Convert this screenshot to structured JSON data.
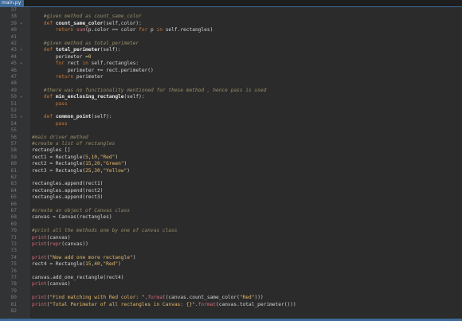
{
  "tab": {
    "label": "main.py"
  },
  "lines": [
    {
      "n": "37",
      "fold": "",
      "indent": "",
      "tokens": []
    },
    {
      "n": "38",
      "fold": "",
      "indent": "    ",
      "tokens": [
        {
          "t": "#given method as count_same_color",
          "c": "t-comment"
        }
      ]
    },
    {
      "n": "39",
      "fold": "▾",
      "indent": "    ",
      "tokens": [
        {
          "t": "def ",
          "c": "t-kw"
        },
        {
          "t": "count_same_color",
          "c": "t-name"
        },
        {
          "t": "(self,color):",
          "c": "t-plain"
        }
      ]
    },
    {
      "n": "40",
      "fold": "",
      "indent": "        ",
      "tokens": [
        {
          "t": "return ",
          "c": "t-kw"
        },
        {
          "t": "sum",
          "c": "t-builtin"
        },
        {
          "t": "(p.color == color ",
          "c": "t-plain"
        },
        {
          "t": "for ",
          "c": "t-kw"
        },
        {
          "t": "p ",
          "c": "t-plain"
        },
        {
          "t": "in ",
          "c": "t-kw"
        },
        {
          "t": "self.rectangles)",
          "c": "t-plain"
        }
      ]
    },
    {
      "n": "41",
      "fold": "",
      "indent": "",
      "tokens": []
    },
    {
      "n": "42",
      "fold": "",
      "indent": "    ",
      "tokens": [
        {
          "t": "#given method as total_perimeter",
          "c": "t-comment"
        }
      ]
    },
    {
      "n": "43",
      "fold": "▾",
      "indent": "    ",
      "tokens": [
        {
          "t": "def ",
          "c": "t-kw"
        },
        {
          "t": "total_perimeter",
          "c": "t-name"
        },
        {
          "t": "(self):",
          "c": "t-plain"
        }
      ]
    },
    {
      "n": "44",
      "fold": "",
      "indent": "        ",
      "tokens": [
        {
          "t": "perimeter =",
          "c": "t-plain"
        },
        {
          "t": "0",
          "c": "t-num"
        }
      ]
    },
    {
      "n": "45",
      "fold": "▾",
      "indent": "        ",
      "tokens": [
        {
          "t": "for ",
          "c": "t-kw"
        },
        {
          "t": "rect ",
          "c": "t-plain"
        },
        {
          "t": "in ",
          "c": "t-kw"
        },
        {
          "t": "self.rectangles:",
          "c": "t-plain"
        }
      ]
    },
    {
      "n": "46",
      "fold": "",
      "indent": "            ",
      "tokens": [
        {
          "t": "perimeter += rect.perimeter()",
          "c": "t-plain"
        }
      ]
    },
    {
      "n": "47",
      "fold": "",
      "indent": "        ",
      "tokens": [
        {
          "t": "return ",
          "c": "t-kw"
        },
        {
          "t": "perimeter",
          "c": "t-plain"
        }
      ]
    },
    {
      "n": "48",
      "fold": "",
      "indent": "",
      "tokens": []
    },
    {
      "n": "49",
      "fold": "",
      "indent": "    ",
      "tokens": [
        {
          "t": "#there was no functionality mentioned for these method , hence pass is used",
          "c": "t-comment"
        }
      ]
    },
    {
      "n": "50",
      "fold": "▾",
      "indent": "    ",
      "tokens": [
        {
          "t": "def ",
          "c": "t-kw"
        },
        {
          "t": "min_enclosing_rectangle",
          "c": "t-name"
        },
        {
          "t": "(self):",
          "c": "t-plain"
        }
      ]
    },
    {
      "n": "51",
      "fold": "",
      "indent": "        ",
      "tokens": [
        {
          "t": "pass",
          "c": "t-kw"
        }
      ]
    },
    {
      "n": "52",
      "fold": "",
      "indent": "",
      "tokens": []
    },
    {
      "n": "53",
      "fold": "▾",
      "indent": "    ",
      "tokens": [
        {
          "t": "def ",
          "c": "t-kw"
        },
        {
          "t": "common_point",
          "c": "t-name"
        },
        {
          "t": "(self):",
          "c": "t-plain"
        }
      ]
    },
    {
      "n": "54",
      "fold": "",
      "indent": "        ",
      "tokens": [
        {
          "t": "pass",
          "c": "t-kw"
        }
      ]
    },
    {
      "n": "55",
      "fold": "",
      "indent": "",
      "tokens": []
    },
    {
      "n": "56",
      "fold": "",
      "indent": "",
      "tokens": [
        {
          "t": "#main driver method",
          "c": "t-comment"
        }
      ]
    },
    {
      "n": "57",
      "fold": "",
      "indent": "",
      "tokens": [
        {
          "t": "#create a list of rectangles",
          "c": "t-comment"
        }
      ]
    },
    {
      "n": "58",
      "fold": "",
      "indent": "",
      "tokens": [
        {
          "t": "rectangles []",
          "c": "t-plain"
        }
      ]
    },
    {
      "n": "59",
      "fold": "",
      "indent": "",
      "tokens": [
        {
          "t": "rect1 = Rectangle(",
          "c": "t-plain"
        },
        {
          "t": "5",
          "c": "t-num"
        },
        {
          "t": ",",
          "c": "t-plain"
        },
        {
          "t": "10",
          "c": "t-num"
        },
        {
          "t": ",",
          "c": "t-plain"
        },
        {
          "t": "\"Red\"",
          "c": "t-str"
        },
        {
          "t": ")",
          "c": "t-plain"
        }
      ]
    },
    {
      "n": "60",
      "fold": "",
      "indent": "",
      "tokens": [
        {
          "t": "rect2 = Rectangle(",
          "c": "t-plain"
        },
        {
          "t": "15",
          "c": "t-num"
        },
        {
          "t": ",",
          "c": "t-plain"
        },
        {
          "t": "20",
          "c": "t-num"
        },
        {
          "t": ",",
          "c": "t-plain"
        },
        {
          "t": "\"Green\"",
          "c": "t-str"
        },
        {
          "t": ")",
          "c": "t-plain"
        }
      ]
    },
    {
      "n": "61",
      "fold": "",
      "indent": "",
      "tokens": [
        {
          "t": "rect3 = Rectangle(",
          "c": "t-plain"
        },
        {
          "t": "25",
          "c": "t-num"
        },
        {
          "t": ",",
          "c": "t-plain"
        },
        {
          "t": "30",
          "c": "t-num"
        },
        {
          "t": ",",
          "c": "t-plain"
        },
        {
          "t": "\"Yellow\"",
          "c": "t-str"
        },
        {
          "t": ")",
          "c": "t-plain"
        }
      ]
    },
    {
      "n": "62",
      "fold": "",
      "indent": "",
      "tokens": []
    },
    {
      "n": "63",
      "fold": "",
      "indent": "",
      "tokens": [
        {
          "t": "rectangles.append(rect1)",
          "c": "t-plain"
        }
      ]
    },
    {
      "n": "64",
      "fold": "",
      "indent": "",
      "tokens": [
        {
          "t": "rectangles.append(rect2)",
          "c": "t-plain"
        }
      ]
    },
    {
      "n": "65",
      "fold": "",
      "indent": "",
      "tokens": [
        {
          "t": "rectangles.append(rect3)",
          "c": "t-plain"
        }
      ]
    },
    {
      "n": "66",
      "fold": "",
      "indent": "",
      "tokens": []
    },
    {
      "n": "67",
      "fold": "",
      "indent": "",
      "tokens": [
        {
          "t": "#create an object of Canvas class",
          "c": "t-comment"
        }
      ]
    },
    {
      "n": "68",
      "fold": "",
      "indent": "",
      "tokens": [
        {
          "t": "canvas = Canvas(rectangles)",
          "c": "t-plain"
        }
      ]
    },
    {
      "n": "69",
      "fold": "",
      "indent": "",
      "tokens": []
    },
    {
      "n": "70",
      "fold": "",
      "indent": "",
      "tokens": [
        {
          "t": "#print all the methods one by one of canvas class",
          "c": "t-comment"
        }
      ]
    },
    {
      "n": "71",
      "fold": "",
      "indent": "",
      "tokens": [
        {
          "t": "print",
          "c": "t-builtin"
        },
        {
          "t": "(canvas)",
          "c": "t-plain"
        }
      ]
    },
    {
      "n": "72",
      "fold": "",
      "indent": "",
      "tokens": [
        {
          "t": "print",
          "c": "t-builtin"
        },
        {
          "t": "(",
          "c": "t-plain"
        },
        {
          "t": "repr",
          "c": "t-builtin"
        },
        {
          "t": "(canvas))",
          "c": "t-plain"
        }
      ]
    },
    {
      "n": "73",
      "fold": "",
      "indent": "",
      "tokens": []
    },
    {
      "n": "74",
      "fold": "",
      "indent": "",
      "tokens": [
        {
          "t": "print",
          "c": "t-builtin"
        },
        {
          "t": "(",
          "c": "t-plain"
        },
        {
          "t": "\"Now add one more rectangle\"",
          "c": "t-str"
        },
        {
          "t": ")",
          "c": "t-plain"
        }
      ]
    },
    {
      "n": "75",
      "fold": "",
      "indent": "",
      "tokens": [
        {
          "t": "rect4 = Rectangle(",
          "c": "t-plain"
        },
        {
          "t": "15",
          "c": "t-num"
        },
        {
          "t": ",",
          "c": "t-plain"
        },
        {
          "t": "40",
          "c": "t-num"
        },
        {
          "t": ",",
          "c": "t-plain"
        },
        {
          "t": "\"Red\"",
          "c": "t-str"
        },
        {
          "t": ")",
          "c": "t-plain"
        }
      ]
    },
    {
      "n": "76",
      "fold": "",
      "indent": "",
      "tokens": []
    },
    {
      "n": "77",
      "fold": "",
      "indent": "",
      "tokens": [
        {
          "t": "canvas.add_one_rectangle(rect4)",
          "c": "t-plain"
        }
      ]
    },
    {
      "n": "78",
      "fold": "",
      "indent": "",
      "tokens": [
        {
          "t": "print",
          "c": "t-builtin"
        },
        {
          "t": "(canvas)",
          "c": "t-plain"
        }
      ]
    },
    {
      "n": "79",
      "fold": "",
      "indent": "",
      "tokens": []
    },
    {
      "n": "80",
      "fold": "",
      "indent": "",
      "tokens": [
        {
          "t": "print",
          "c": "t-builtin"
        },
        {
          "t": "(",
          "c": "t-plain"
        },
        {
          "t": "\"Find matching with Red color: \"",
          "c": "t-str"
        },
        {
          "t": ".",
          "c": "t-plain"
        },
        {
          "t": "format",
          "c": "t-builtin"
        },
        {
          "t": "(canvas.count_same_color(",
          "c": "t-plain"
        },
        {
          "t": "\"Red\"",
          "c": "t-str"
        },
        {
          "t": ")))",
          "c": "t-plain"
        }
      ]
    },
    {
      "n": "81",
      "fold": "",
      "indent": "",
      "tokens": [
        {
          "t": "print",
          "c": "t-builtin"
        },
        {
          "t": "(",
          "c": "t-plain"
        },
        {
          "t": "\"Total Perimeter of all rectangles in Canvas: {}\"",
          "c": "t-str"
        },
        {
          "t": ".",
          "c": "t-plain"
        },
        {
          "t": "format",
          "c": "t-builtin"
        },
        {
          "t": "(canvas.total_perimeter()))",
          "c": "t-plain"
        }
      ]
    },
    {
      "n": "82",
      "fold": "",
      "indent": "",
      "tokens": []
    }
  ]
}
